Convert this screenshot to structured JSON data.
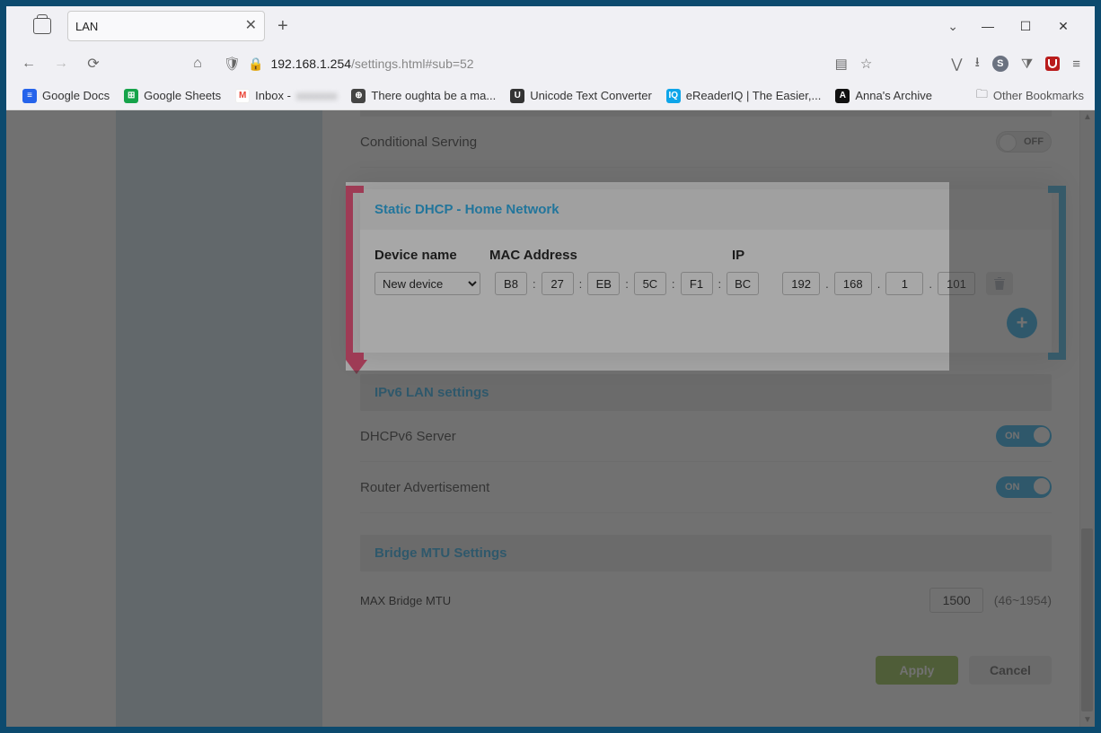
{
  "browser": {
    "tab_title": "LAN",
    "url_host": "192.168.1.254",
    "url_path": "/settings.html#sub=52"
  },
  "bookmarks": {
    "gdocs": "Google Docs",
    "gsheets": "Google Sheets",
    "inbox": "Inbox - ",
    "oughta": "There oughta be a ma...",
    "unicode": "Unicode Text Converter",
    "ereader": "eReaderIQ | The Easier,...",
    "anna": "Anna's Archive",
    "other": "Other Bookmarks"
  },
  "settings": {
    "conditional_serving": {
      "label": "Conditional Serving",
      "state": "OFF"
    },
    "dhcpv6": {
      "label": "DHCPv6 Server",
      "state": "ON"
    },
    "router_adv": {
      "label": "Router Advertisement",
      "state": "ON"
    }
  },
  "static_dhcp": {
    "title": "Static DHCP - Home Network",
    "col_device": "Device name",
    "col_mac": "MAC Address",
    "col_ip": "IP",
    "row": {
      "device": "New device",
      "mac": [
        "B8",
        "27",
        "EB",
        "5C",
        "F1",
        "BC"
      ],
      "ip": [
        "192",
        "168",
        "1",
        "101"
      ]
    }
  },
  "ipv6": {
    "title": "IPv6 LAN settings"
  },
  "mtu": {
    "title": "Bridge MTU Settings",
    "label": "MAX Bridge MTU",
    "value": "1500",
    "range": "(46~1954)"
  },
  "buttons": {
    "apply": "Apply",
    "cancel": "Cancel"
  }
}
